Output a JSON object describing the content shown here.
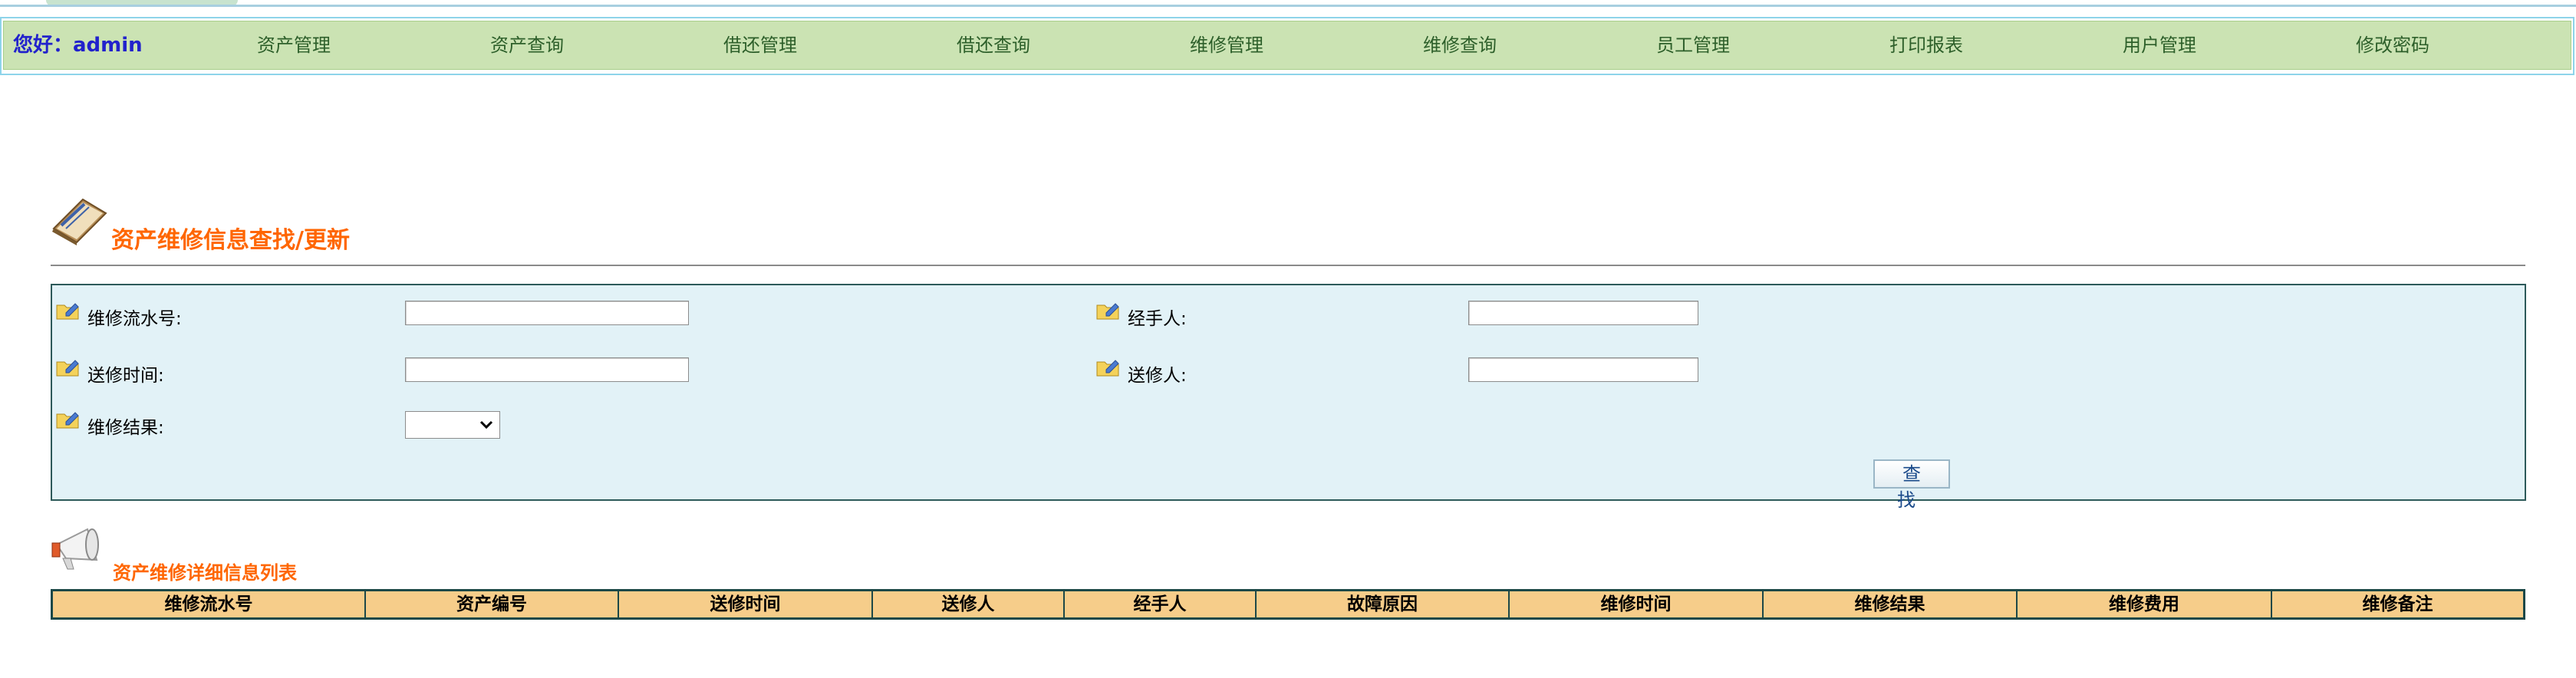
{
  "nav": {
    "greeting": "您好：admin",
    "items": [
      "资产管理",
      "资产查询",
      "借还管理",
      "借还查询",
      "维修管理",
      "维修查询",
      "员工管理",
      "打印报表",
      "用户管理",
      "修改密码"
    ]
  },
  "page": {
    "title": "资产维修信息查找/更新"
  },
  "search": {
    "repair_no_label": "维修流水号:",
    "handler_label": "经手人:",
    "send_time_label": "送修时间:",
    "sender_label": "送修人:",
    "result_label": "维修结果:",
    "repair_no_value": "",
    "handler_value": "",
    "send_time_value": "",
    "sender_value": "",
    "result_selected": "",
    "find_button": "查 找"
  },
  "list": {
    "title": "资产维修详细信息列表",
    "columns": [
      "维修流水号",
      "资产编号",
      "送修时间",
      "送修人",
      "经手人",
      "故障原因",
      "维修时间",
      "维修结果",
      "维修费用",
      "维修备注"
    ]
  },
  "colors": {
    "nav_bg": "#cbe3b3",
    "accent_orange": "#ff6600",
    "panel_bg": "#e2f2f7",
    "table_header_bg": "#f6cd8a"
  }
}
